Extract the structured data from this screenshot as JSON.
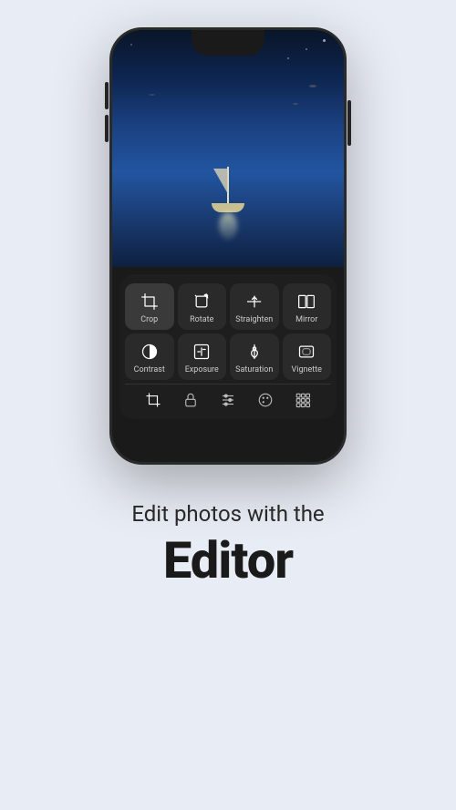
{
  "page": {
    "background": "#e8ecf4"
  },
  "phone": {
    "tools_row1": [
      {
        "id": "crop",
        "label": "Crop",
        "icon": "crop"
      },
      {
        "id": "rotate",
        "label": "Rotate",
        "icon": "rotate"
      },
      {
        "id": "straighten",
        "label": "Straighten",
        "icon": "straighten"
      },
      {
        "id": "mirror",
        "label": "Mirror",
        "icon": "mirror"
      }
    ],
    "tools_row2": [
      {
        "id": "contrast",
        "label": "Contrast",
        "icon": "contrast"
      },
      {
        "id": "exposure",
        "label": "Exposure",
        "icon": "exposure"
      },
      {
        "id": "saturation",
        "label": "Saturation",
        "icon": "saturation"
      },
      {
        "id": "vignette",
        "label": "Vignette",
        "icon": "vignette"
      }
    ],
    "nav_icons": [
      "crop-nav",
      "lock-nav",
      "sliders-nav",
      "palette-nav",
      "grid-nav"
    ]
  },
  "text": {
    "subtitle": "Edit photos with the",
    "title": "Editor"
  }
}
